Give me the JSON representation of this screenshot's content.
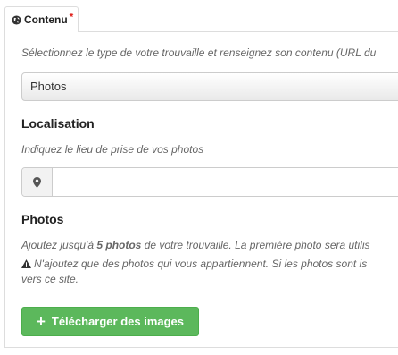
{
  "tab": {
    "label": "Contenu",
    "required_mark": "*"
  },
  "type_help": "Sélectionnez le type de votre trouvaille et renseignez son contenu (URL du",
  "type_select": {
    "value": "Photos"
  },
  "location": {
    "label": "Localisation",
    "help": "Indiquez le lieu de prise de vos photos",
    "input_value": ""
  },
  "photos": {
    "label": "Photos",
    "help_prefix": "Ajoutez jusqu'à",
    "help_bold": "5 photos",
    "help_suffix": "de votre trouvaille. La première photo sera utilis",
    "warning_line1": "N'ajoutez que des photos qui vous appartiennent. Si les photos sont is",
    "warning_line2": "vers ce site.",
    "upload_button": "Télécharger des images"
  }
}
